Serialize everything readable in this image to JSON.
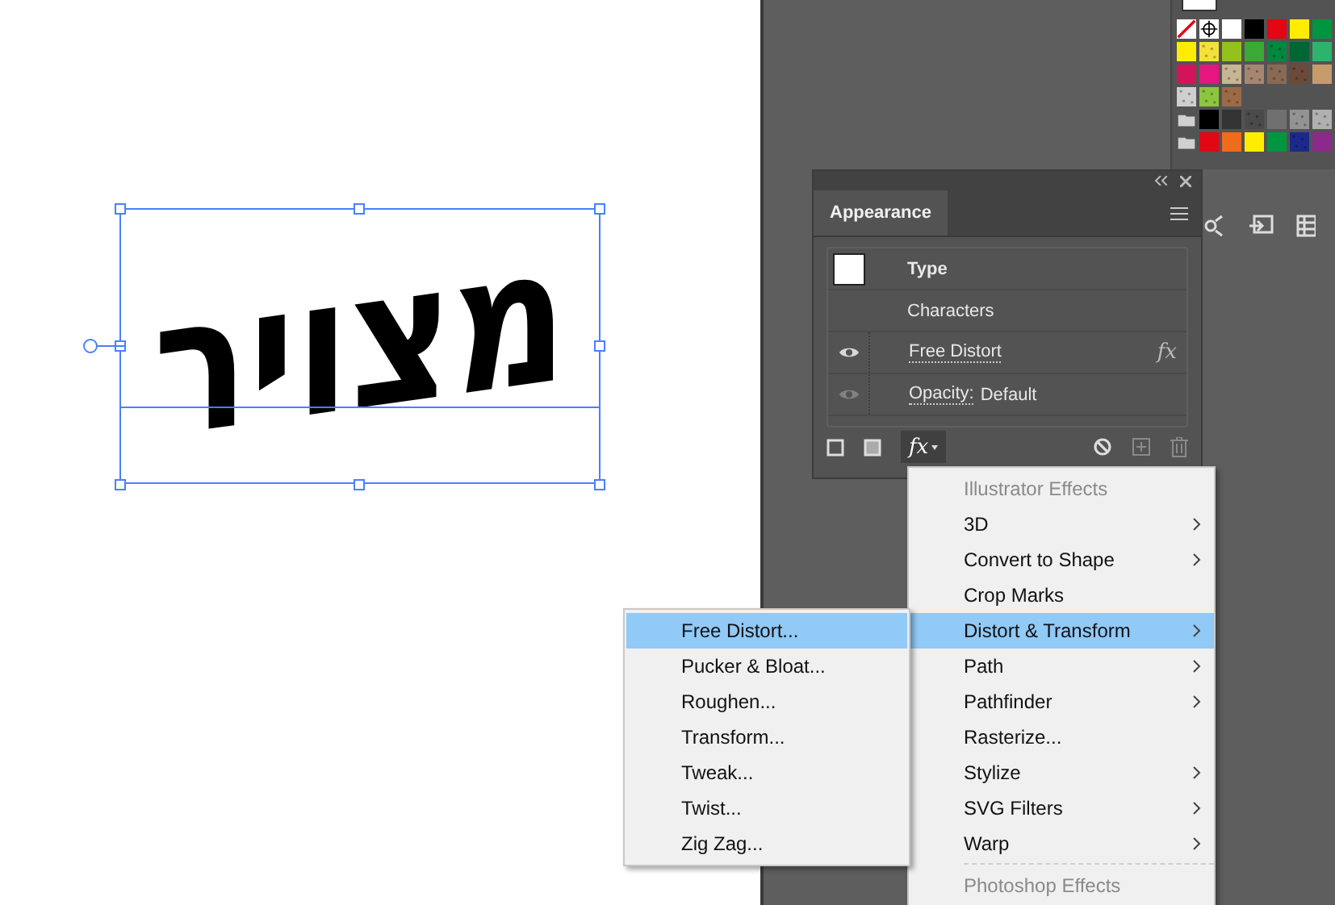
{
  "artwork": {
    "text": "מצויר"
  },
  "swatches": {
    "rows": [
      [
        {
          "kind": "none",
          "color": "#ffffff"
        },
        {
          "kind": "registration",
          "color": "#ffffff"
        },
        {
          "kind": "solid",
          "color": "#ffffff"
        },
        {
          "kind": "solid",
          "color": "#000000"
        },
        {
          "kind": "solid",
          "color": "#e30613"
        },
        {
          "kind": "solid",
          "color": "#ffed00"
        },
        {
          "kind": "solid",
          "color": "#009640"
        }
      ],
      [
        {
          "kind": "solid",
          "color": "#ffed00"
        },
        {
          "kind": "pattern",
          "color": "#f4e03a"
        },
        {
          "kind": "solid",
          "color": "#95c11f"
        },
        {
          "kind": "solid",
          "color": "#3aaa35"
        },
        {
          "kind": "pattern",
          "color": "#00893c"
        },
        {
          "kind": "solid",
          "color": "#006633"
        },
        {
          "kind": "solid",
          "color": "#2db36b"
        }
      ],
      [
        {
          "kind": "solid",
          "color": "#d4145a"
        },
        {
          "kind": "solid",
          "color": "#e6157f"
        },
        {
          "kind": "pattern",
          "color": "#c8b593"
        },
        {
          "kind": "pattern",
          "color": "#a58771"
        },
        {
          "kind": "pattern",
          "color": "#8a6a55"
        },
        {
          "kind": "pattern",
          "color": "#6b4a3a"
        },
        {
          "kind": "solid",
          "color": "#c69c6d"
        }
      ],
      [
        {
          "kind": "pattern",
          "color": "#cfcfcf"
        },
        {
          "kind": "pattern",
          "color": "#8cc63f"
        },
        {
          "kind": "pattern",
          "color": "#9b6b45"
        }
      ],
      [
        {
          "kind": "folder",
          "color": "#d0d0d0"
        },
        {
          "kind": "solid",
          "color": "#000000"
        },
        {
          "kind": "solid",
          "color": "#333333"
        },
        {
          "kind": "pattern",
          "color": "#4a4a4a"
        },
        {
          "kind": "solid",
          "color": "#707070"
        },
        {
          "kind": "pattern",
          "color": "#939393"
        },
        {
          "kind": "pattern",
          "color": "#b0b0b0"
        }
      ],
      [
        {
          "kind": "folder",
          "color": "#d0d0d0"
        },
        {
          "kind": "solid",
          "color": "#e30613"
        },
        {
          "kind": "solid",
          "color": "#f06b1b"
        },
        {
          "kind": "solid",
          "color": "#ffed00"
        },
        {
          "kind": "solid",
          "color": "#009640"
        },
        {
          "kind": "pattern",
          "color": "#1b2a8a"
        },
        {
          "kind": "solid",
          "color": "#8b2a8a"
        }
      ]
    ]
  },
  "appearance": {
    "tab": "Appearance",
    "rows": [
      {
        "kind": "header",
        "label": "Type"
      },
      {
        "kind": "plain",
        "label": "Characters"
      },
      {
        "kind": "effect",
        "label": "Free Distort",
        "visible": true,
        "badge": "fx"
      },
      {
        "kind": "attribute",
        "label": "Opacity:",
        "value": "Default",
        "visible": false
      }
    ],
    "fx_button": "fx"
  },
  "effects_menu": {
    "items": [
      {
        "kind": "header",
        "label": "Illustrator Effects"
      },
      {
        "kind": "item",
        "label": "3D",
        "submenu": true,
        "selected": false
      },
      {
        "kind": "item",
        "label": "Convert to Shape",
        "submenu": true,
        "selected": false
      },
      {
        "kind": "item",
        "label": "Crop Marks",
        "submenu": false,
        "selected": false
      },
      {
        "kind": "item",
        "label": "Distort & Transform",
        "submenu": true,
        "selected": true
      },
      {
        "kind": "item",
        "label": "Path",
        "submenu": true,
        "selected": false
      },
      {
        "kind": "item",
        "label": "Pathfinder",
        "submenu": true,
        "selected": false
      },
      {
        "kind": "item",
        "label": "Rasterize...",
        "submenu": false,
        "selected": false
      },
      {
        "kind": "item",
        "label": "Stylize",
        "submenu": true,
        "selected": false
      },
      {
        "kind": "item",
        "label": "SVG Filters",
        "submenu": true,
        "selected": false
      },
      {
        "kind": "item",
        "label": "Warp",
        "submenu": true,
        "selected": false
      },
      {
        "kind": "separator"
      },
      {
        "kind": "header",
        "label": "Photoshop Effects"
      }
    ]
  },
  "distort_submenu": {
    "items": [
      {
        "label": "Free Distort...",
        "selected": true
      },
      {
        "label": "Pucker & Bloat...",
        "selected": false
      },
      {
        "label": "Roughen...",
        "selected": false
      },
      {
        "label": "Transform...",
        "selected": false
      },
      {
        "label": "Tweak...",
        "selected": false
      },
      {
        "label": "Twist...",
        "selected": false
      },
      {
        "label": "Zig Zag...",
        "selected": false
      }
    ]
  }
}
